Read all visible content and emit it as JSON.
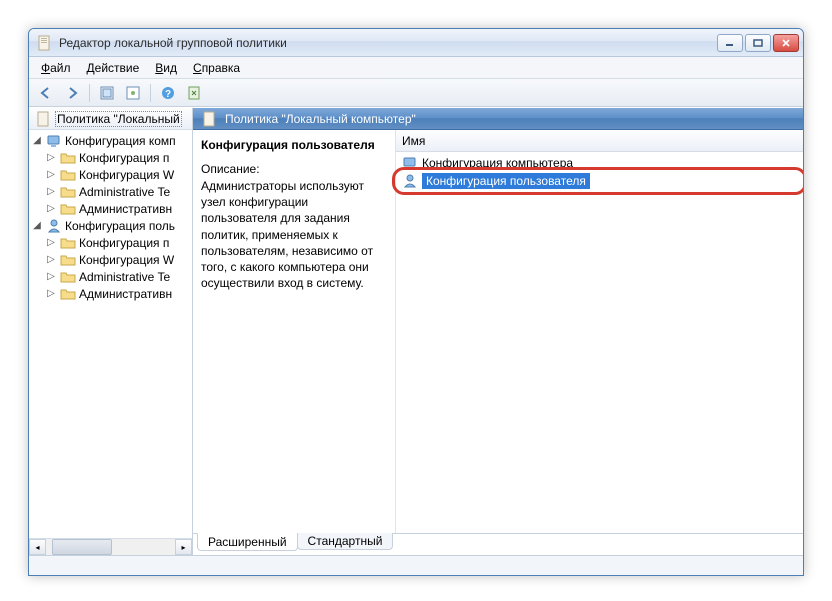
{
  "window": {
    "title": "Редактор локальной групповой политики"
  },
  "menu": {
    "file": "Файл",
    "action": "Действие",
    "view": "Вид",
    "help": "Справка"
  },
  "tree": {
    "root": "Политика \"Локальный",
    "comp_config": "Конфигурация комп",
    "comp_items": [
      "Конфигурация п",
      "Конфигурация W",
      "Administrative Te",
      "Административн"
    ],
    "user_config": "Конфигурация поль",
    "user_items": [
      "Конфигурация п",
      "Конфигурация W",
      "Administrative Te",
      "Административн"
    ]
  },
  "main": {
    "header": "Политика \"Локальный компьютер\"",
    "detail_title": "Конфигурация пользователя",
    "desc_label": "Описание:",
    "desc_text": "Администраторы используют узел конфигурации пользователя для задания политик, применяемых к пользователям, независимо от того, с какого компьютера они осуществили вход в систему.",
    "col_name": "Имя",
    "items": [
      "Конфигурация компьютера",
      "Конфигурация пользователя"
    ]
  },
  "tabs": {
    "extended": "Расширенный",
    "standard": "Стандартный"
  }
}
